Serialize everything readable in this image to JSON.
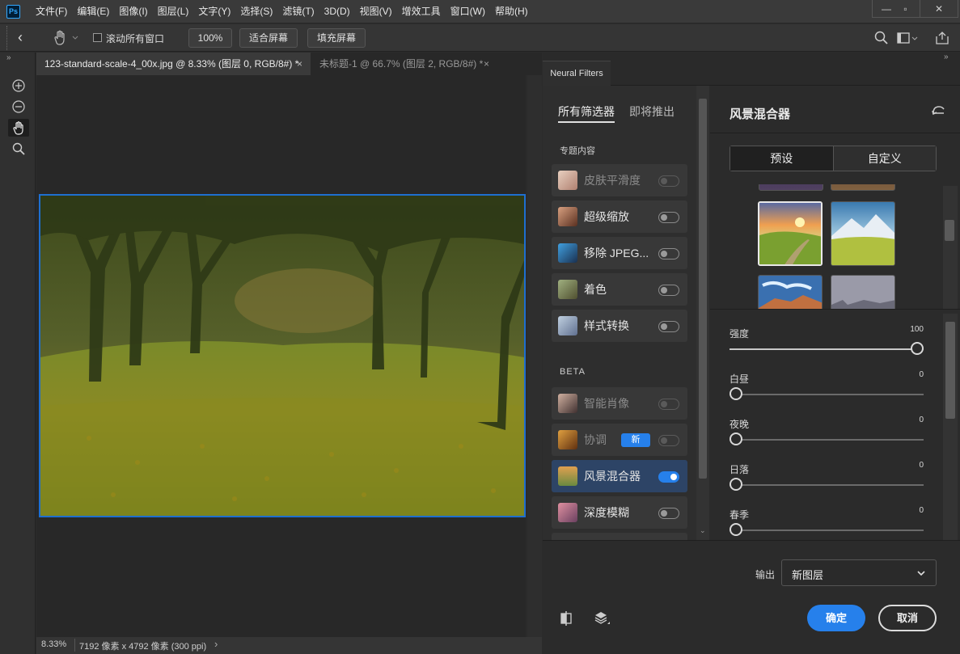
{
  "app": {
    "logo": "Ps"
  },
  "menu": [
    "文件(F)",
    "编辑(E)",
    "图像(I)",
    "图层(L)",
    "文字(Y)",
    "选择(S)",
    "滤镜(T)",
    "3D(D)",
    "视图(V)",
    "增效工具",
    "窗口(W)",
    "帮助(H)"
  ],
  "options": {
    "scroll_all_label": "滚动所有窗口",
    "zoom_value": "100%",
    "fit_screen": "适合屏幕",
    "fill_screen": "填充屏幕"
  },
  "tabs": [
    {
      "label": "123-standard-scale-4_00x.jpg @ 8.33% (图层 0, RGB/8#) *",
      "close": "×"
    },
    {
      "label": "未标题-1 @ 66.7% (图层 2, RGB/8#) *",
      "close": "×"
    }
  ],
  "status": {
    "zoom": "8.33%",
    "doc_info": "7192 像素 x 4792 像素 (300 ppi)"
  },
  "neural": {
    "panel_tab": "Neural Filters",
    "tab_all": "所有筛选器",
    "tab_coming": "即将推出",
    "section_featured": "专题内容",
    "section_beta": "BETA",
    "featured": [
      {
        "label": "皮肤平滑度",
        "enabled": false,
        "available": false
      },
      {
        "label": "超级缩放",
        "enabled": false,
        "available": true
      },
      {
        "label": "移除 JPEG...",
        "enabled": false,
        "available": true
      },
      {
        "label": "着色",
        "enabled": false,
        "available": true
      },
      {
        "label": "样式转换",
        "enabled": false,
        "available": true
      }
    ],
    "beta": [
      {
        "label": "智能肖像",
        "enabled": false,
        "available": false
      },
      {
        "label": "协调",
        "enabled": false,
        "available": false,
        "badge": "新"
      },
      {
        "label": "风景混合器",
        "enabled": true,
        "available": true
      },
      {
        "label": "深度模糊",
        "enabled": false,
        "available": true
      }
    ],
    "detail_title": "风景混合器",
    "seg_preset": "预设",
    "seg_custom": "自定义",
    "sliders": [
      {
        "label": "强度",
        "value": "100",
        "fraction": 1.0
      },
      {
        "label": "白昼",
        "value": "0",
        "fraction": 0
      },
      {
        "label": "夜晚",
        "value": "0",
        "fraction": 0
      },
      {
        "label": "日落",
        "value": "0",
        "fraction": 0
      },
      {
        "label": "春季",
        "value": "0",
        "fraction": 0
      }
    ],
    "output_label": "输出",
    "output_value": "新图层",
    "ok": "确定",
    "cancel": "取消"
  },
  "colors": {
    "accent": "#2680eb",
    "selection": "#1e6fd0"
  }
}
